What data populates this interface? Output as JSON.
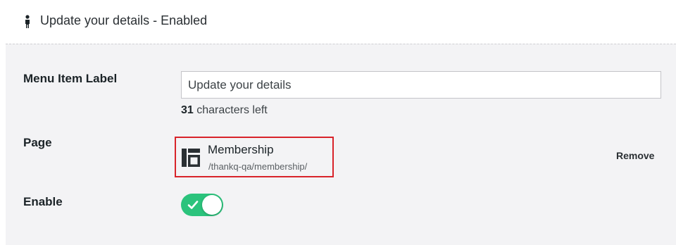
{
  "header": {
    "icon": "user-icon",
    "title": "Update your details - Enabled"
  },
  "fields": {
    "menu_item_label": {
      "label": "Menu Item Label",
      "value": "Update your details",
      "chars_left_count": "31",
      "chars_left_text": "characters left"
    },
    "page": {
      "label": "Page",
      "selected": {
        "icon": "page-layout-icon",
        "name": "Membership",
        "path": "/thankq-qa/membership/"
      },
      "remove_label": "Remove"
    },
    "enable": {
      "label": "Enable",
      "value": true,
      "check_icon": "checkmark-icon"
    }
  },
  "colors": {
    "accent_green": "#2bc37c",
    "highlight_red": "#d8232a",
    "panel_bg": "#f3f3f5"
  }
}
